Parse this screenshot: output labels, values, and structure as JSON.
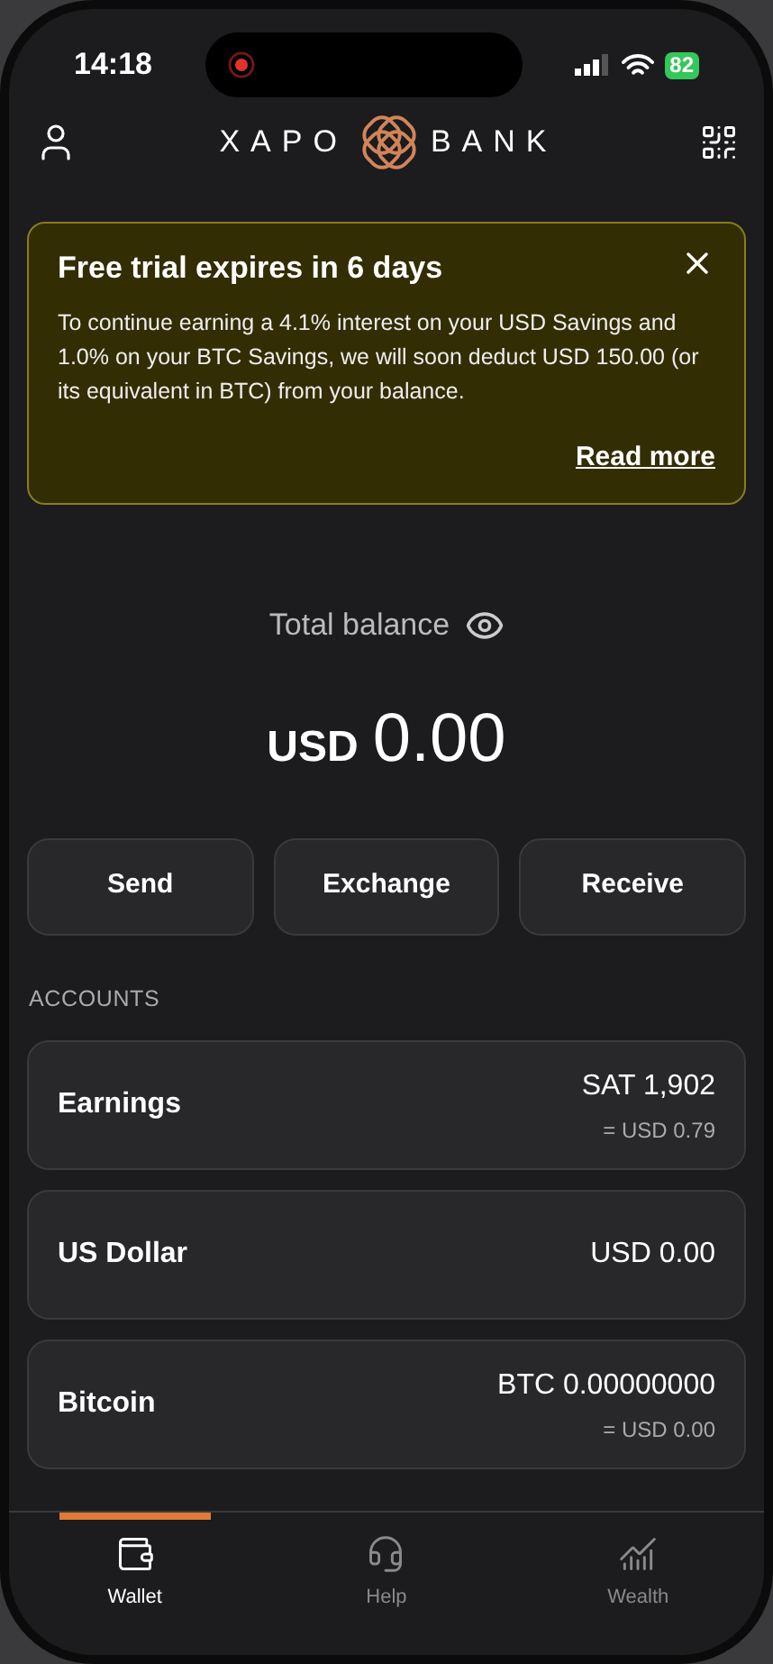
{
  "status_bar": {
    "time": "14:18",
    "battery": "82"
  },
  "header": {
    "logo_left": "XAPO",
    "logo_right": "BANK"
  },
  "banner": {
    "title": "Free trial expires in 6 days",
    "body": "To continue earning a 4.1% interest on your USD Savings and 1.0% on your BTC Savings, we will soon deduct USD 150.00 (or its equivalent in BTC) from your balance.",
    "link": "Read more"
  },
  "balance": {
    "label": "Total balance",
    "currency": "USD",
    "amount": "0.00"
  },
  "actions": [
    "Send",
    "Exchange",
    "Receive"
  ],
  "accounts_heading": "ACCOUNTS",
  "accounts": [
    {
      "name": "Earnings",
      "amount": "SAT 1,902",
      "converted": "= USD 0.79"
    },
    {
      "name": "US Dollar",
      "amount": "USD 0.00"
    },
    {
      "name": "Bitcoin",
      "amount": "BTC 0.00000000",
      "converted": "= USD 0.00"
    }
  ],
  "tabs": [
    {
      "label": "Wallet",
      "kind": "wallet",
      "selected": true
    },
    {
      "label": "Help",
      "kind": "help",
      "selected": false
    },
    {
      "label": "Wealth",
      "kind": "wealth",
      "selected": false
    }
  ]
}
